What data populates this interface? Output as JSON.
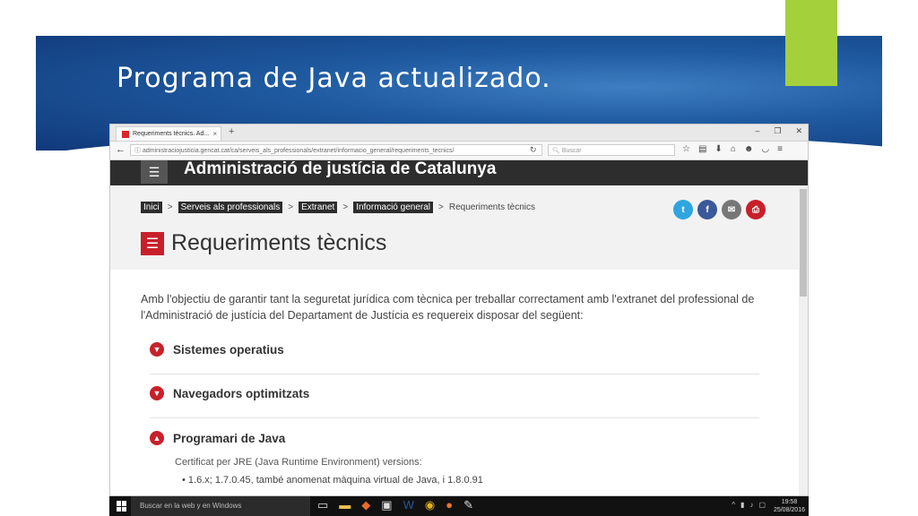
{
  "slide": {
    "title": "Programa de Java actualizado.",
    "accent_color": "#a4d03c"
  },
  "browser": {
    "tab_title": "Requeriments tècnics. Ad...",
    "tab_close": "×",
    "new_tab": "+",
    "win_min": "–",
    "win_max": "❐",
    "win_close": "✕",
    "url": "administraciojusticia.gencat.cat/ca/serveis_als_professionals/extranet/informacio_general/requeriments_tecnics/",
    "search_placeholder": "Buscar",
    "icons": [
      "star-icon",
      "reading-list-icon",
      "download-icon",
      "home-icon",
      "chat-icon",
      "pocket-icon",
      "menu-icon"
    ]
  },
  "site": {
    "menu_glyph": "☰",
    "title": "Administració de justícia de Catalunya",
    "breadcrumbs": [
      "Inici",
      "Serveis als professionals",
      "Extranet",
      "Informació general"
    ],
    "breadcrumb_current": "Requeriments tècnics",
    "separator": ">",
    "social": [
      {
        "name": "twitter",
        "glyph": "t",
        "color": "#2fa5df"
      },
      {
        "name": "facebook",
        "glyph": "f",
        "color": "#3b5998"
      },
      {
        "name": "email",
        "glyph": "✉",
        "color": "#777777"
      },
      {
        "name": "print",
        "glyph": "⎙",
        "color": "#c8202a"
      }
    ],
    "heading_glyph": "☰",
    "heading": "Requeriments tècnics",
    "intro": "Amb l'objectiu de garantir tant la seguretat jurídica com tècnica per treballar correctament amb l'extranet del professional de l'Administració de justícia del Departament de Justícia es requereix disposar del següent:",
    "sections": [
      {
        "label": "Sistemes operatius",
        "expanded": false
      },
      {
        "label": "Navegadors optimitzats",
        "expanded": false
      },
      {
        "label": "Programari de Java",
        "expanded": true
      }
    ],
    "java_sub": "Certificat per JRE (Java Runtime Environment) versions:",
    "java_bullet": "• 1.6.x; 1.7.0.45, també anomenat màquina virtual de Java, i 1.8.0.91"
  },
  "taskbar": {
    "search_placeholder": "Buscar en la web y en Windows",
    "time": "19:58",
    "date": "25/08/2016"
  }
}
